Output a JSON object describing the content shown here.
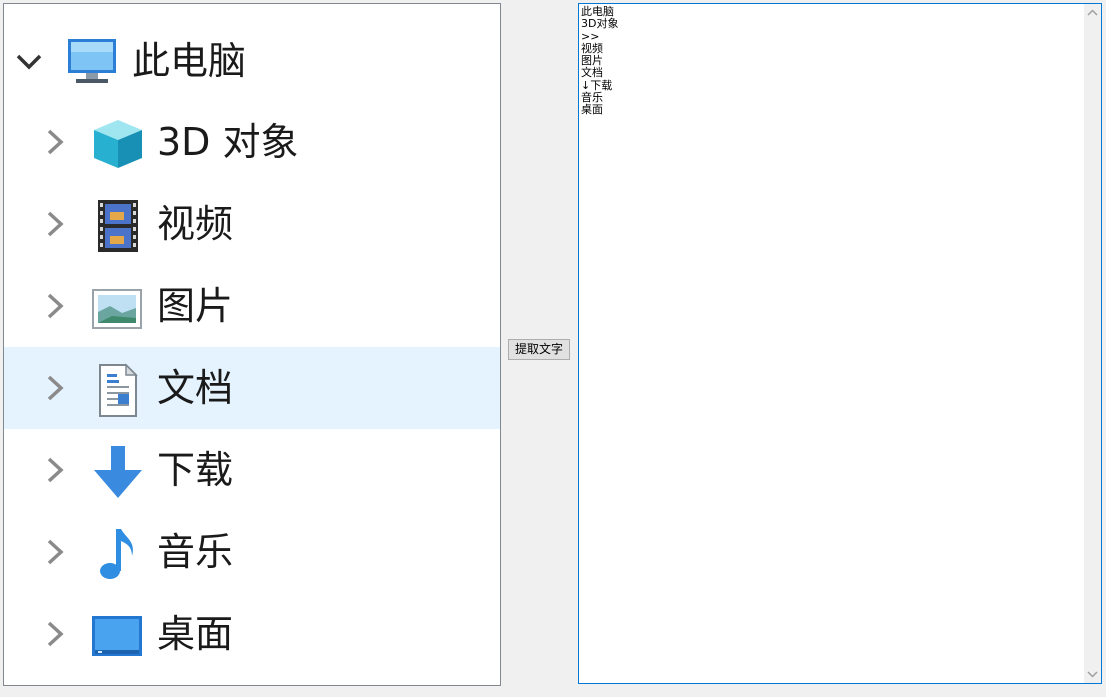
{
  "tree": {
    "root": {
      "label": "此电脑",
      "icon": "computer-icon",
      "expanded": true
    },
    "items": [
      {
        "label": "3D 对象",
        "icon": "cube-3d-icon",
        "selected": false
      },
      {
        "label": "视频",
        "icon": "video-film-icon",
        "selected": false
      },
      {
        "label": "图片",
        "icon": "picture-icon",
        "selected": false
      },
      {
        "label": "文档",
        "icon": "document-icon",
        "selected": true
      },
      {
        "label": "下载",
        "icon": "download-arrow-icon",
        "selected": false
      },
      {
        "label": "音乐",
        "icon": "music-note-icon",
        "selected": false
      },
      {
        "label": "桌面",
        "icon": "desktop-icon",
        "selected": false
      }
    ]
  },
  "button": {
    "label": "提取文字"
  },
  "output": {
    "text": "此电脑\n3D对象\n>>\n视频\n图片\n文档\n↓下载\n音乐\n桌面"
  },
  "colors": {
    "selection": "#e5f3ff",
    "focus_border": "#0078d7",
    "panel_border": "#828790"
  }
}
